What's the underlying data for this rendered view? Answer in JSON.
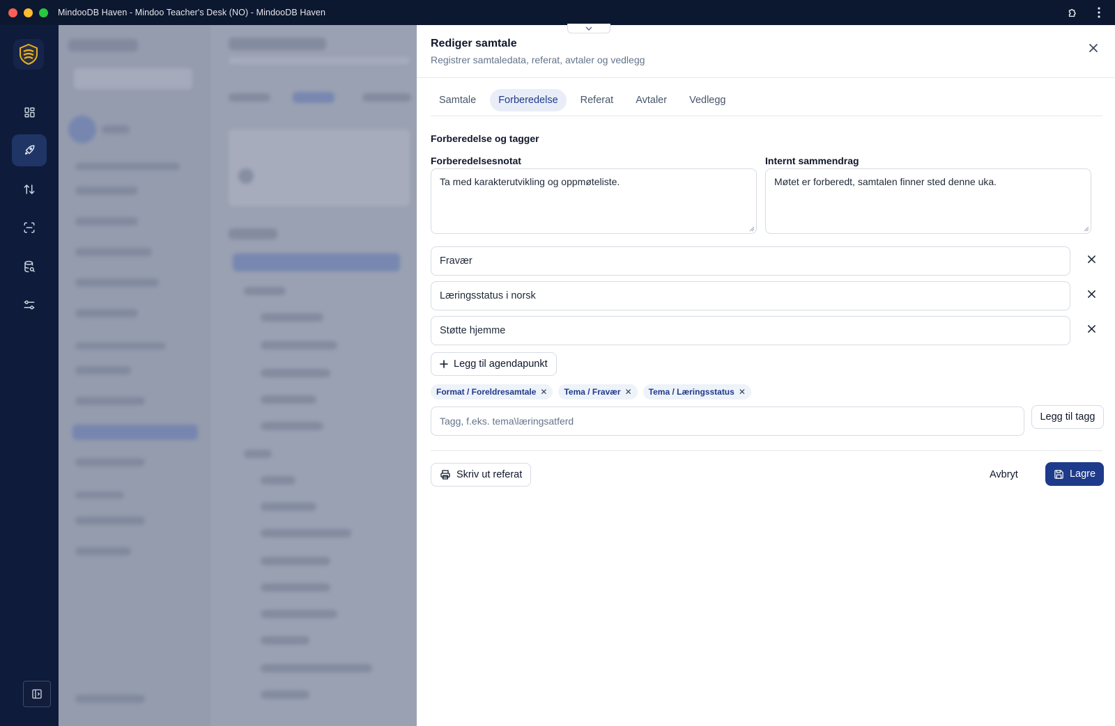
{
  "window": {
    "title": "MindooDB Haven - Mindoo Teacher's Desk (NO) - MindooDB Haven"
  },
  "rail": {
    "items": [
      {
        "icon": "dashboard-grid-icon",
        "active": false
      },
      {
        "icon": "rocket-icon",
        "active": true
      },
      {
        "icon": "sort-arrows-icon",
        "active": false
      },
      {
        "icon": "scan-icon",
        "active": false
      },
      {
        "icon": "database-search-icon",
        "active": false
      },
      {
        "icon": "sliders-icon",
        "active": false
      }
    ],
    "bottom_icon": "sidebar-toggle-icon"
  },
  "drawer": {
    "title": "Rediger samtale",
    "subtitle": "Registrer samtaledata, referat, avtaler og vedlegg",
    "tabs": [
      {
        "label": "Samtale",
        "active": false
      },
      {
        "label": "Forberedelse",
        "active": true
      },
      {
        "label": "Referat",
        "active": false
      },
      {
        "label": "Avtaler",
        "active": false
      },
      {
        "label": "Vedlegg",
        "active": false
      }
    ],
    "section_title": "Forberedelse og tagger",
    "prep_note": {
      "label": "Forberedelsesnotat",
      "value": "Ta med karakterutvikling og oppmøteliste."
    },
    "internal_summary": {
      "label": "Internt sammendrag",
      "value": "Møtet er forberedt, samtalen finner sted denne uka."
    },
    "agenda": [
      "Fravær",
      "Læringsstatus i norsk",
      "Støtte hjemme"
    ],
    "add_agenda_label": "Legg til agendapunkt",
    "tags": [
      "Format / Foreldresamtale",
      "Tema / Fravær",
      "Tema / Læringsstatus"
    ],
    "tag_input_placeholder": "Tagg, f.eks. tema\\læringsatferd",
    "add_tag_label": "Legg til tagg",
    "print_label": "Skriv ut referat",
    "cancel_label": "Avbryt",
    "save_label": "Lagre"
  },
  "colors": {
    "primary": "#1e3a8a",
    "active_tab_bg": "#e8edf7",
    "rail_bg": "#0f1b3a",
    "titlebar_bg": "#0c1730"
  }
}
